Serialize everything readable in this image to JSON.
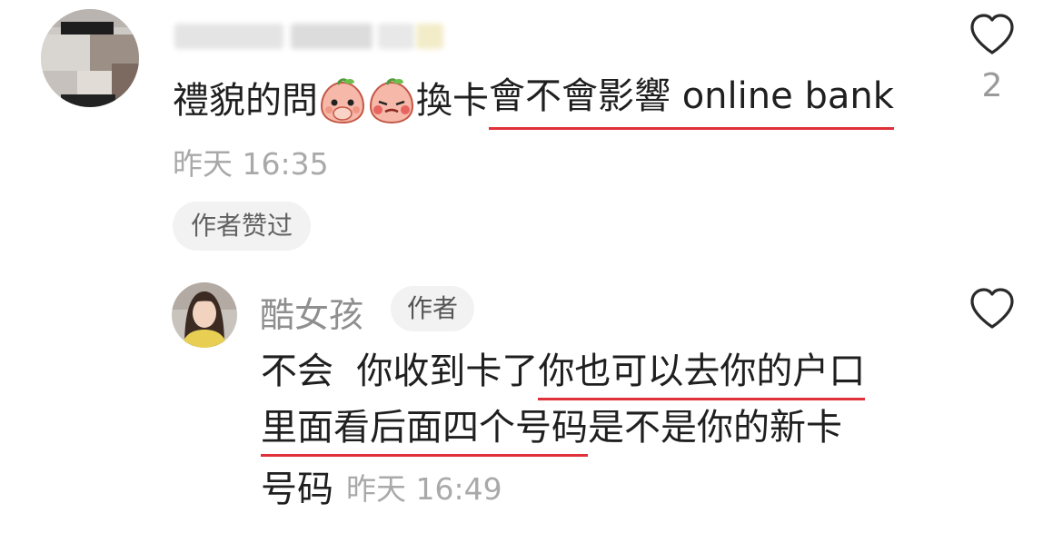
{
  "comment": {
    "avatar_icon": "blurred-avatar",
    "username": "",
    "text_prefix": "禮貌的問",
    "emoji_1": "peach-covering-mouth-emoji",
    "emoji_2": "peach-embarrassed-emoji",
    "text_after_emoji": "換卡",
    "text_underlined": "會不會影響 online bank",
    "timestamp": "昨天 16:35",
    "liked_by_author_badge": "作者赞过",
    "like_icon": "heart-outline-icon",
    "like_count": "2"
  },
  "reply": {
    "avatar_icon": "author-avatar",
    "author_name": "酷女孩",
    "author_badge": "作者",
    "like_icon": "heart-outline-icon",
    "line1_plain": "不会  你收到卡了",
    "line1_underlined": "你也可以去你的户口",
    "line2_underlined": "里面看后面四个号码",
    "line2_plain": "是不是你的新卡",
    "line3_plain": "号码",
    "timestamp": "昨天 16:49"
  },
  "colors": {
    "underline": "#e0303a",
    "muted_text": "#a9a9a9",
    "badge_bg": "#f2f2f2"
  }
}
